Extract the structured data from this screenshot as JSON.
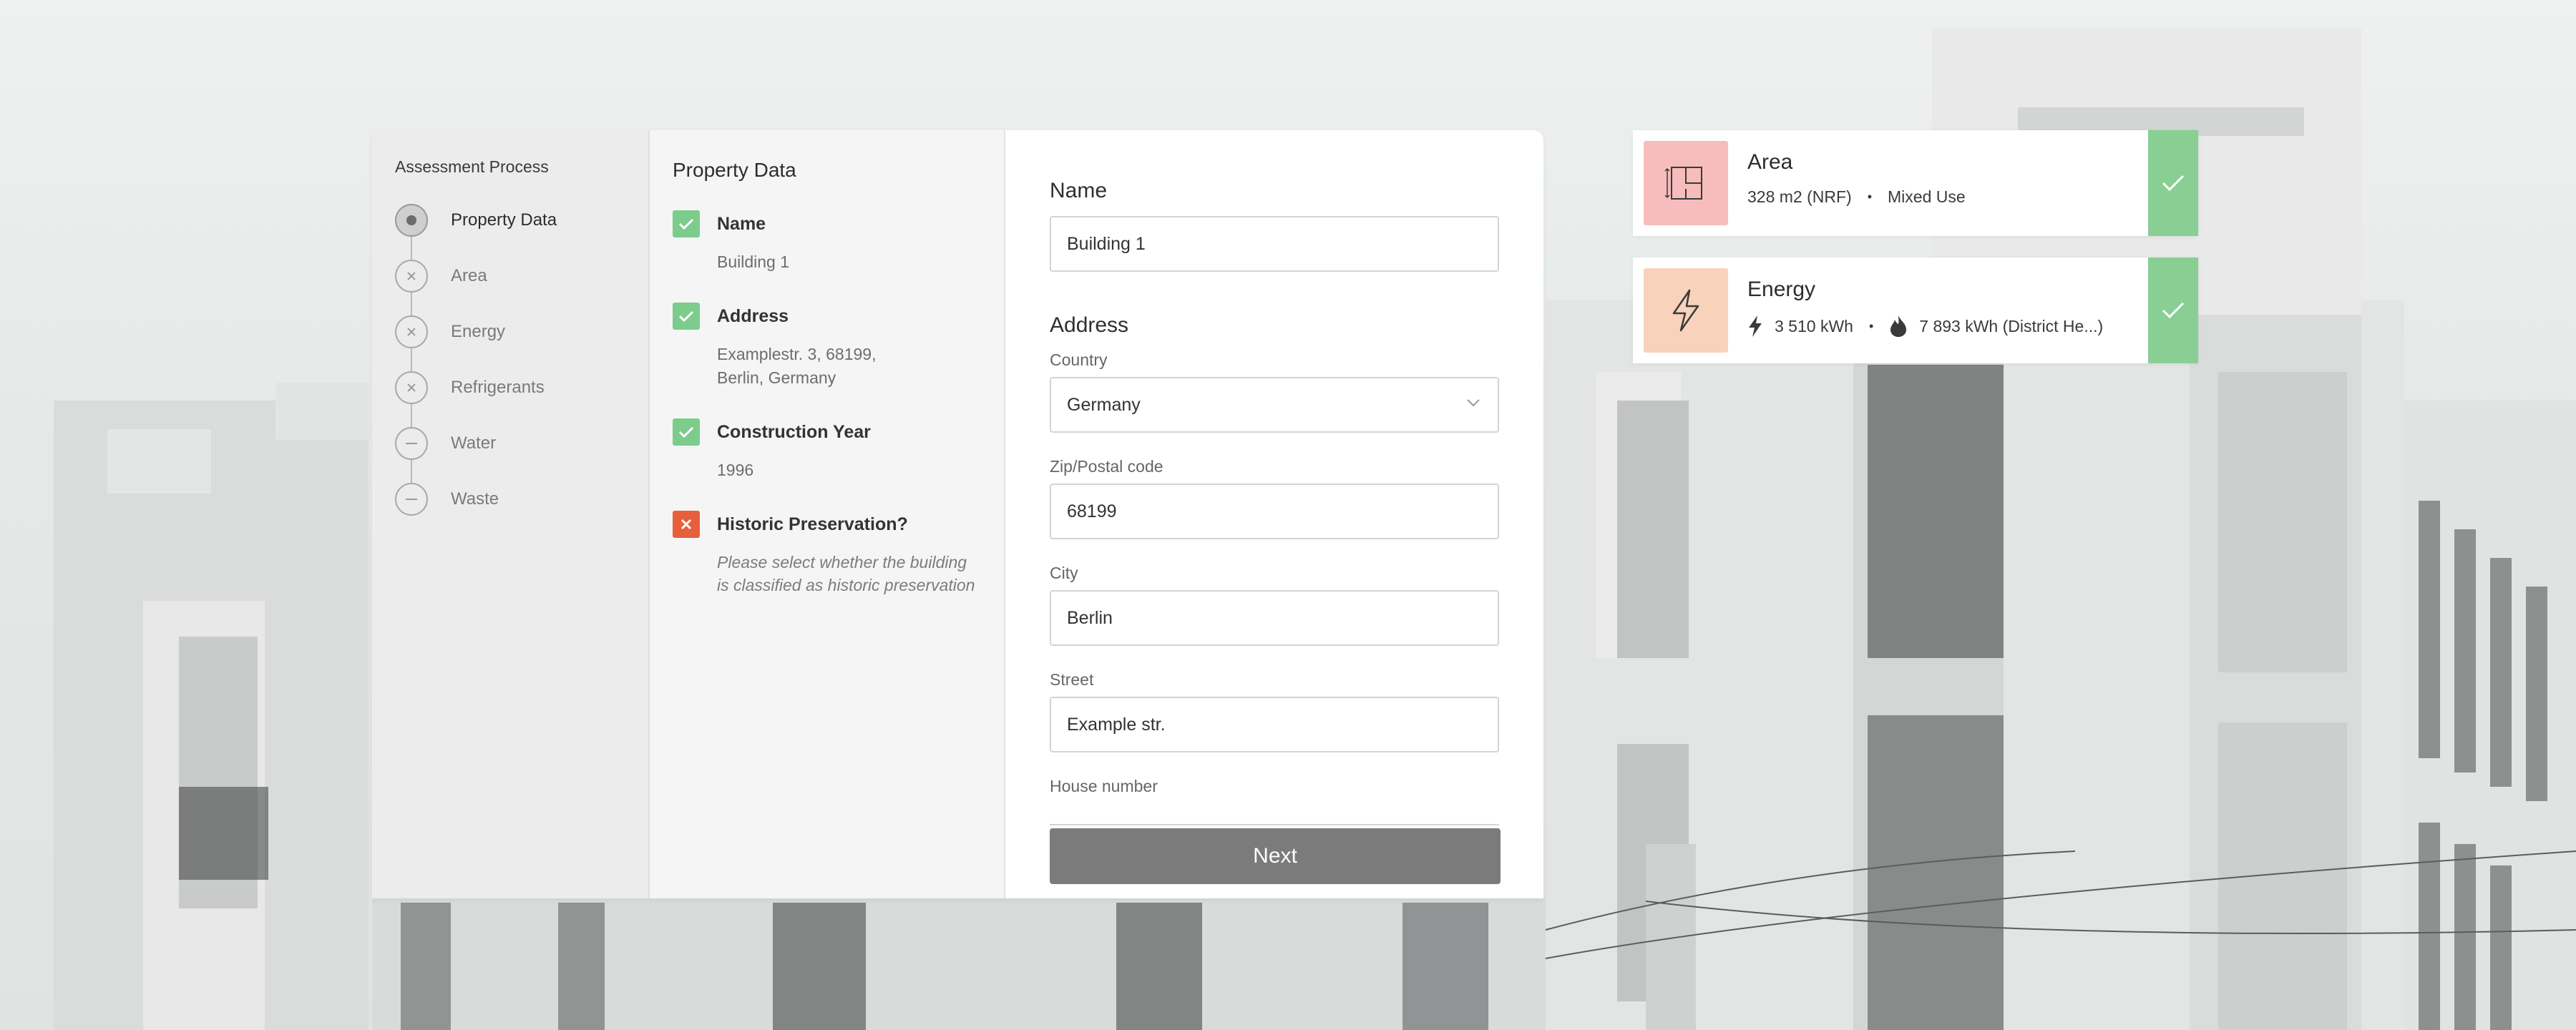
{
  "steps": {
    "title": "Assessment Process",
    "items": [
      {
        "label": "Property Data",
        "state": "active"
      },
      {
        "label": "Area",
        "state": "error"
      },
      {
        "label": "Energy",
        "state": "error"
      },
      {
        "label": "Refrigerants",
        "state": "error"
      },
      {
        "label": "Water",
        "state": "skipped"
      },
      {
        "label": "Waste",
        "state": "skipped"
      }
    ]
  },
  "summary": {
    "title": "Property Data",
    "items": [
      {
        "label": "Name",
        "value": "Building 1",
        "status": "complete"
      },
      {
        "label": "Address",
        "value": "Examplestr. 3, 68199,\nBerlin, Germany",
        "status": "complete"
      },
      {
        "label": "Construction Year",
        "value": "1996",
        "status": "complete"
      },
      {
        "label": "Historic Preservation?",
        "value": "Please select whether the building is classified as historic preservation",
        "status": "missing"
      }
    ]
  },
  "form": {
    "name_heading": "Name",
    "name_value": "Building 1",
    "address_heading": "Address",
    "country_label": "Country",
    "country_value": "Germany",
    "zip_label": "Zip/Postal code",
    "zip_value": "68199",
    "city_label": "City",
    "city_value": "Berlin",
    "street_label": "Street",
    "street_value": "Example str.",
    "house_number_label": "House number",
    "next_label": "Next"
  },
  "cards": {
    "area": {
      "title": "Area",
      "value": "328 m2 (NRF)",
      "separator": "•",
      "usage": "Mixed Use",
      "icon_bg": "#f7bcbc",
      "icon": "floorplan-icon"
    },
    "energy": {
      "title": "Energy",
      "electricity": "3 510 kWh",
      "separator": "•",
      "heating": "7 893 kWh (District He...)",
      "icon_bg": "#f8d2bb",
      "icon": "lightning-icon"
    },
    "check_color": "#89cf94"
  },
  "colors": {
    "check_ok": "#7ccc8c",
    "check_bad": "#e7603c",
    "button": "#7b7b7b"
  }
}
